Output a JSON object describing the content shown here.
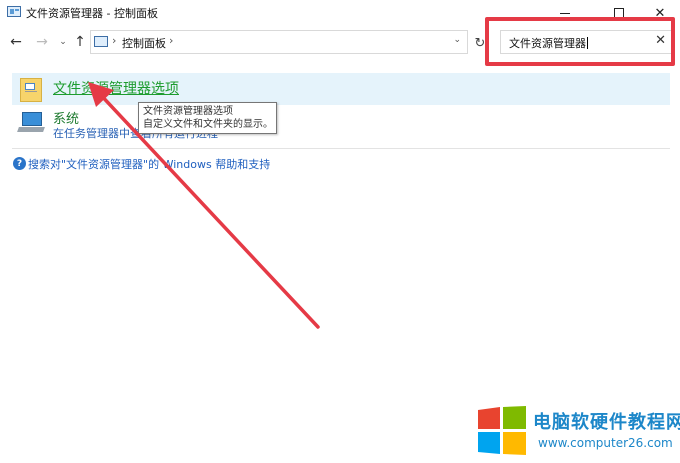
{
  "window": {
    "title": "文件资源管理器 - 控制面板",
    "minimize_glyph": "",
    "close_glyph": "✕"
  },
  "nav": {
    "back_glyph": "←",
    "forward_glyph": "→",
    "recent_glyph": "⌄",
    "up_glyph": "↑",
    "refresh_glyph": "↻"
  },
  "address": {
    "separator": "›",
    "crumb": "控制面板",
    "dropdown_glyph": "⌄"
  },
  "search": {
    "value": "文件资源管理器",
    "clear_glyph": "✕"
  },
  "results": [
    {
      "title": "文件资源管理器选项"
    },
    {
      "title": "系统",
      "subtitle": "在任务管理器中查看所有运行进程"
    }
  ],
  "tooltip": {
    "line1": "文件资源管理器选项",
    "line2": "自定义文件和文件夹的显示。"
  },
  "help": {
    "icon_glyph": "?",
    "link": "搜索对\"文件资源管理器\"的 Windows 帮助和支持"
  },
  "watermark": {
    "title": "电脑软硬件教程网",
    "url": "www.computer26.com"
  },
  "colors": {
    "annotation_red": "#e53a46",
    "link_green": "#1d9c2e",
    "link_blue": "#1f5fbf",
    "selection_bg": "#e5f3fb",
    "watermark_blue": "#1d87c9"
  }
}
